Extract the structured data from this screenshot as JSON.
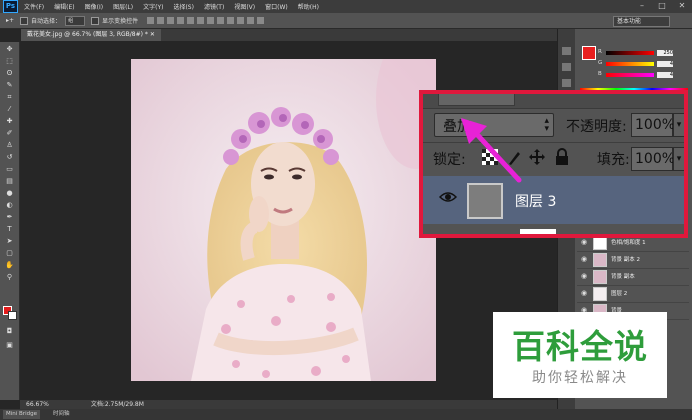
{
  "app": {
    "logo": "Ps"
  },
  "menu": [
    "文件(F)",
    "编辑(E)",
    "图像(I)",
    "图层(L)",
    "文字(Y)",
    "选择(S)",
    "滤镜(T)",
    "视图(V)",
    "窗口(W)",
    "帮助(H)"
  ],
  "options": {
    "auto_select": "自动选择：",
    "auto_select_value": "组",
    "show_transform": "显示变换控件",
    "workspace": "基本功能"
  },
  "document": {
    "tab": "戴花美女.jpg @ 66.7% (图层 3, RGB/8#) *"
  },
  "status": {
    "zoom": "66.67%",
    "doc_size": "文档:2.75M/29.8M"
  },
  "bottom_tabs": [
    "Mini Bridge",
    "时间轴"
  ],
  "color_panel": {
    "channels": [
      {
        "label": "R",
        "value": "250"
      },
      {
        "label": "G",
        "value": "4"
      },
      {
        "label": "B",
        "value": "4"
      }
    ],
    "fg_color": "#e81f1f"
  },
  "layers_panel": {
    "blend_mode": "叠加",
    "opacity_label": "不透明度:",
    "opacity_value": "100%",
    "lock_label": "锁定:",
    "fill_label": "填充:",
    "fill_value": "100%",
    "active_layer": "图层 3",
    "layers": [
      {
        "name": "色相/饱和度 1"
      },
      {
        "name": "背景 副本 2"
      },
      {
        "name": "背景 副本"
      },
      {
        "name": "图层 2"
      },
      {
        "name": "背景"
      }
    ]
  },
  "watermark": {
    "title": "百科全说",
    "subtitle": "助你轻松解决"
  },
  "accent_colors": {
    "callout_border": "#e0183c",
    "arrow": "#e822d6",
    "watermark_green": "#2e9d3b"
  }
}
